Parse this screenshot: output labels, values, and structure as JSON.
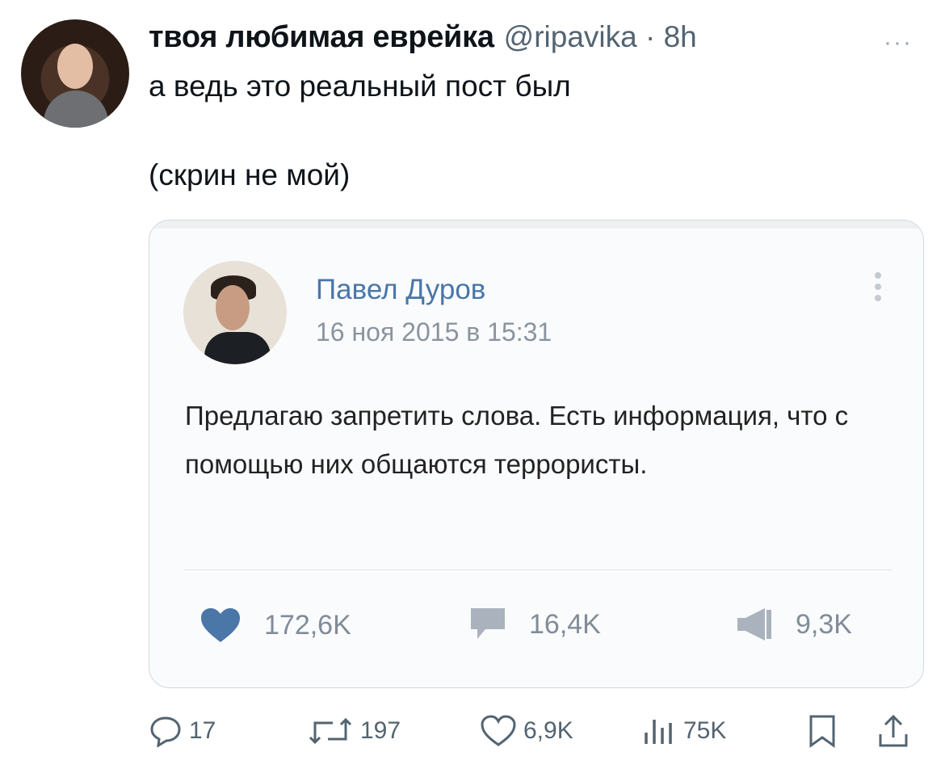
{
  "tweet": {
    "author_name": "твоя любимая еврейка",
    "handle_time": "@ripavika · 8h",
    "more_label": "···",
    "line1": "а ведь это реальный пост был",
    "line2": "(скрин не мой)"
  },
  "embedded_post": {
    "author": "Павел Дуров",
    "date": "16 ноя 2015 в 15:31",
    "body": "Предлагаю запретить слова. Есть информация, что с помощью них общаются террористы.",
    "likes": "172,6K",
    "comments": "16,4K",
    "reposts": "9,3K",
    "accent_color": "#4a76a8"
  },
  "actions": {
    "replies": "17",
    "retweets": "197",
    "likes": "6,9K",
    "views": "75K"
  },
  "icons": [
    "reply-icon",
    "retweet-icon",
    "like-icon",
    "views-icon",
    "bookmark-icon",
    "share-icon",
    "heart-icon",
    "comment-icon",
    "megaphone-icon"
  ]
}
